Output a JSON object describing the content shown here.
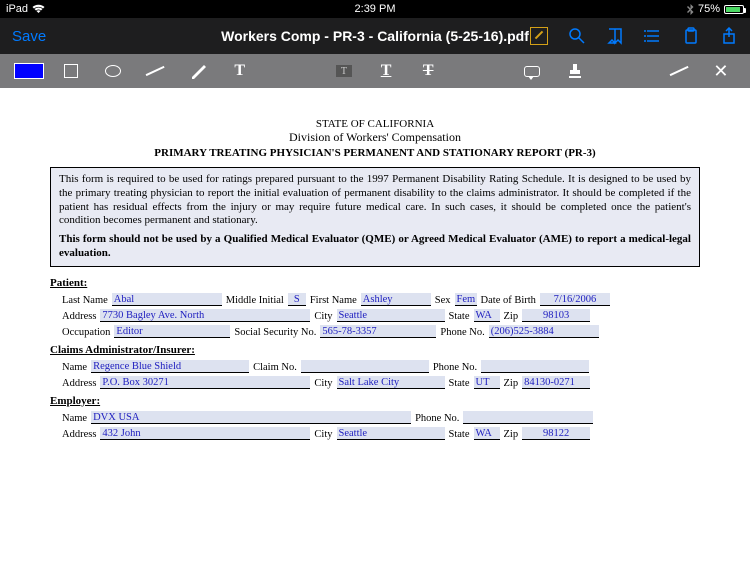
{
  "statusbar": {
    "device": "iPad",
    "time": "2:39 PM",
    "battery": "75%"
  },
  "navbar": {
    "save": "Save",
    "title": "Workers Comp - PR-3 - California (5-25-16).pdf"
  },
  "toolbar": {
    "color": "#0000ff",
    "text_tool": "T",
    "highlight": "T",
    "underline": "T",
    "strike": "T",
    "close": "✕"
  },
  "document": {
    "state": "STATE OF CALIFORNIA",
    "division": "Division of Workers' Compensation",
    "title": "PRIMARY TREATING PHYSICIAN'S PERMANENT AND STATIONARY REPORT (PR-3)",
    "info_text": "This form is required to be used for ratings prepared pursuant to the 1997 Permanent Disability Rating Schedule. It is designed to be used by the primary treating physician to report the initial evaluation of permanent disability to the claims administrator.  It should be completed if the patient has residual effects from the injury or may require future medical care.  In such cases, it should be completed once the patient's condition becomes permanent and stationary.",
    "info_bold": "This form should not be used by a Qualified Medical Evaluator (QME) or Agreed Medical Evaluator (AME) to report a medical-legal evaluation.",
    "section_patient": "Patient:",
    "section_claims": "Claims Administrator/Insurer:",
    "section_employer": "Employer:",
    "labels": {
      "last_name": "Last Name",
      "middle_initial": "Middle Initial",
      "first_name": "First Name",
      "sex": "Sex",
      "dob": "Date of Birth",
      "address": "Address",
      "city": "City",
      "state": "State",
      "zip": "Zip",
      "occupation": "Occupation",
      "ssn": "Social Security No.",
      "phone": "Phone No.",
      "name": "Name",
      "claim_no": "Claim No."
    },
    "patient": {
      "last_name": "Abal",
      "middle_initial": "S",
      "first_name": "Ashley",
      "sex": "Fem",
      "dob": "7/16/2006",
      "address": "7730 Bagley Ave. North",
      "city": "Seattle",
      "state": "WA",
      "zip": "98103",
      "occupation": "Editor",
      "ssn": "565-78-3357",
      "phone": "(206)525-3884"
    },
    "claims": {
      "name": "Regence Blue Shield",
      "claim_no": "",
      "phone": "",
      "address": "P.O. Box 30271",
      "city": "Salt Lake City",
      "state": "UT",
      "zip": "84130-0271"
    },
    "employer": {
      "name": "DVX USA",
      "phone": "",
      "address": "432 John",
      "city": "Seattle",
      "state": "WA",
      "zip": "98122"
    }
  }
}
